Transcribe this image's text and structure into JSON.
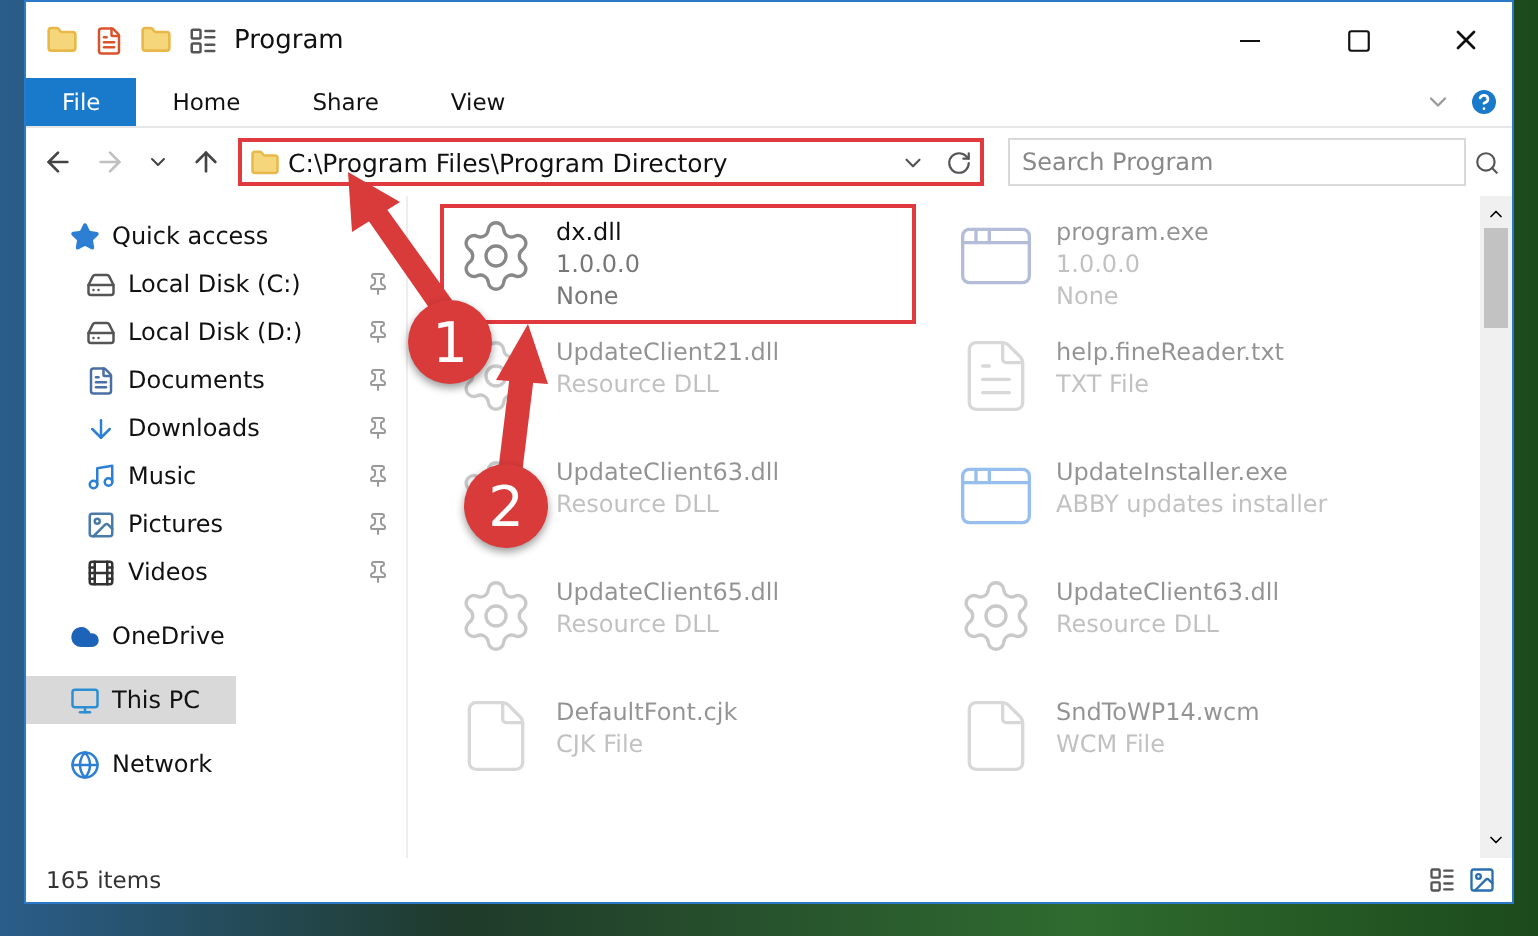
{
  "window": {
    "title": "Program"
  },
  "ribbon": {
    "tabs": [
      {
        "label": "File",
        "selected": true
      },
      {
        "label": "Home",
        "selected": false
      },
      {
        "label": "Share",
        "selected": false
      },
      {
        "label": "View",
        "selected": false
      }
    ]
  },
  "address_bar": {
    "path": "C:\\Program Files\\Program Directory",
    "highlighted": true
  },
  "search": {
    "placeholder": "Search Program"
  },
  "sidebar": {
    "items": [
      {
        "label": "Quick access",
        "kind": "star",
        "selected": false,
        "children": [
          {
            "label": "Local Disk (C:)",
            "kind": "drive",
            "pinned": true,
            "selected": false
          },
          {
            "label": "Local Disk (D:)",
            "kind": "drive",
            "pinned": true,
            "selected": false
          },
          {
            "label": "Documents",
            "kind": "document",
            "pinned": true,
            "selected": false
          },
          {
            "label": "Downloads",
            "kind": "download",
            "pinned": true,
            "selected": false
          },
          {
            "label": "Music",
            "kind": "music",
            "pinned": true,
            "selected": false
          },
          {
            "label": "Pictures",
            "kind": "picture",
            "pinned": true,
            "selected": false
          },
          {
            "label": "Videos",
            "kind": "video",
            "pinned": true,
            "selected": false
          }
        ]
      },
      {
        "label": "OneDrive",
        "kind": "cloud",
        "selected": false
      },
      {
        "label": "This PC",
        "kind": "pc",
        "selected": true
      },
      {
        "label": "Network",
        "kind": "network",
        "selected": false
      }
    ]
  },
  "files": [
    {
      "name": "dx.dll",
      "details": [
        "1.0.0.0",
        "None"
      ],
      "kind": "dll",
      "highlighted": true,
      "faded": false
    },
    {
      "name": "program.exe",
      "details": [
        "1.0.0.0",
        "None"
      ],
      "kind": "exe",
      "highlighted": false,
      "faded": true
    },
    {
      "name": "UpdateClient21.dll",
      "details": [
        "Resource DLL"
      ],
      "kind": "dll",
      "highlighted": false,
      "faded": true
    },
    {
      "name": "help.fineReader.txt",
      "details": [
        "TXT File"
      ],
      "kind": "txt",
      "highlighted": false,
      "faded": true
    },
    {
      "name": "UpdateClient63.dll",
      "details": [
        "Resource DLL"
      ],
      "kind": "dll",
      "highlighted": false,
      "faded": true
    },
    {
      "name": "UpdateInstaller.exe",
      "details": [
        "ABBY updates installer"
      ],
      "kind": "installer",
      "highlighted": false,
      "faded": true
    },
    {
      "name": "UpdateClient65.dll",
      "details": [
        "Resource DLL"
      ],
      "kind": "dll",
      "highlighted": false,
      "faded": true
    },
    {
      "name": "UpdateClient63.dll",
      "details": [
        "Resource DLL"
      ],
      "kind": "dll",
      "highlighted": false,
      "faded": true
    },
    {
      "name": "DefaultFont.cjk",
      "details": [
        "CJK File"
      ],
      "kind": "blank",
      "highlighted": false,
      "faded": true
    },
    {
      "name": "SndToWP14.wcm",
      "details": [
        "WCM File"
      ],
      "kind": "blank",
      "highlighted": false,
      "faded": true
    }
  ],
  "status_bar": {
    "item_count": "165 items"
  },
  "annotations": [
    {
      "number": "1"
    },
    {
      "number": "2"
    }
  ]
}
